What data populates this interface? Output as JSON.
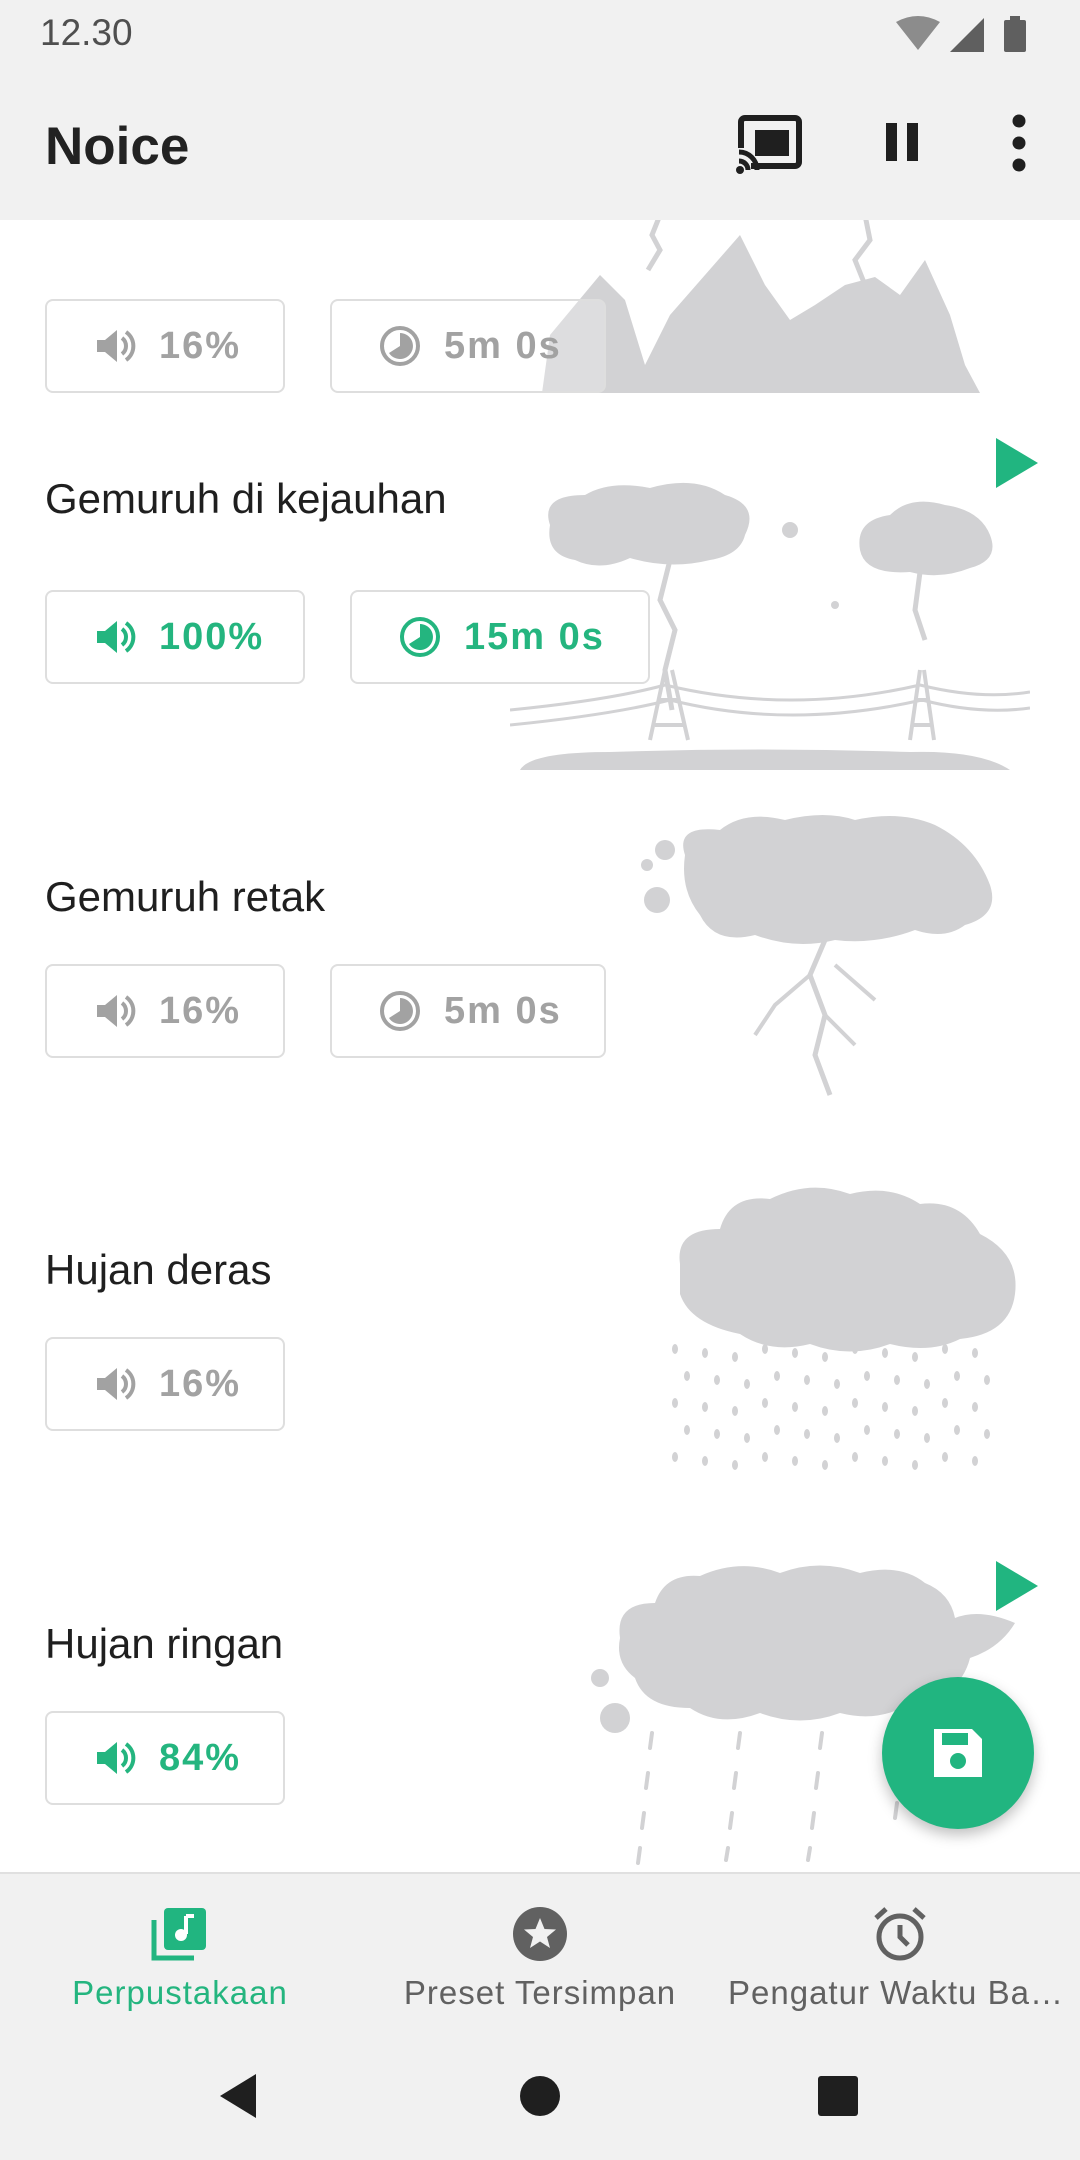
{
  "status_bar": {
    "time": "12.30",
    "icons": [
      "wifi-icon",
      "signal-icon",
      "battery-icon"
    ]
  },
  "app_bar": {
    "title": "Noice",
    "actions": [
      "cast-icon",
      "pause-icon",
      "more-vert-icon"
    ]
  },
  "colors": {
    "accent": "#21b580",
    "inactive_text": "#a2a2a2",
    "illustration": "#d2d2d4",
    "bar_bg": "#f1f1f1"
  },
  "sounds": [
    {
      "title": "",
      "volume": "16%",
      "timer": "5m 0s",
      "active": false,
      "illustration": "thunder-mountains-illustration"
    },
    {
      "title": "Gemuruh di kejauhan",
      "volume": "100%",
      "timer": "15m 0s",
      "active": true,
      "playing": true,
      "illustration": "distant-thunder-illustration"
    },
    {
      "title": "Gemuruh retak",
      "volume": "16%",
      "timer": "5m 0s",
      "active": false,
      "illustration": "crackling-thunder-illustration"
    },
    {
      "title": "Hujan deras",
      "volume": "16%",
      "active": false,
      "illustration": "heavy-rain-illustration"
    },
    {
      "title": "Hujan ringan",
      "volume": "84%",
      "active": true,
      "playing": true,
      "illustration": "light-rain-illustration"
    }
  ],
  "fab": {
    "icon": "save-icon"
  },
  "bottom_nav": [
    {
      "label": "Perpustakaan",
      "icon": "library-music-icon",
      "active": true
    },
    {
      "label": "Preset Tersimpan",
      "icon": "star-icon",
      "active": false
    },
    {
      "label": "Pengatur Waktu Bangun",
      "icon": "alarm-icon",
      "active": false
    }
  ],
  "system_nav": [
    "back-icon",
    "home-icon",
    "recents-icon"
  ]
}
